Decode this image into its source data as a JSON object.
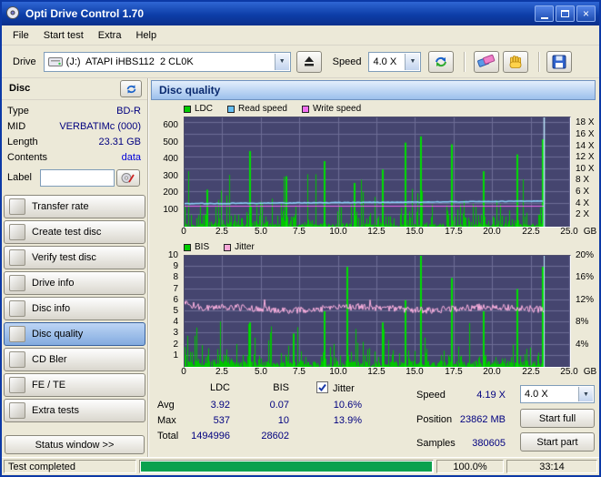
{
  "window": {
    "title": "Opti Drive Control 1.70"
  },
  "menu": {
    "items": [
      "File",
      "Start test",
      "Extra",
      "Help"
    ]
  },
  "toolbar": {
    "drive_label": "Drive",
    "drive_value": "(J:)  ATAPI iHBS112  2 CL0K",
    "speed_label": "Speed",
    "speed_value": "4.0 X"
  },
  "sidebar": {
    "header": "Disc",
    "info": {
      "type_label": "Type",
      "type_value": "BD-R",
      "mid_label": "MID",
      "mid_value": "VERBATIMc (000)",
      "length_label": "Length",
      "length_value": "23.31 GB",
      "contents_label": "Contents",
      "contents_value": "data",
      "label_label": "Label",
      "label_value": ""
    },
    "buttons": [
      "Transfer rate",
      "Create test disc",
      "Verify test disc",
      "Drive info",
      "Disc info",
      "Disc quality",
      "CD Bler",
      "FE / TE",
      "Extra tests"
    ],
    "active_button": "Disc quality",
    "status_window": "Status window >>"
  },
  "main": {
    "header": "Disc quality"
  },
  "results": {
    "col_ldc": "LDC",
    "col_bis": "BIS",
    "col_jitter": "Jitter",
    "jitter_checked": true,
    "rows": [
      {
        "label": "Avg",
        "ldc": "3.92",
        "bis": "0.07",
        "jitter": "10.6%"
      },
      {
        "label": "Max",
        "ldc": "537",
        "bis": "10",
        "jitter": "13.9%"
      },
      {
        "label": "Total",
        "ldc": "1494996",
        "bis": "28602",
        "jitter": ""
      }
    ],
    "speed_label": "Speed",
    "speed_value": "4.19 X",
    "speed_select": "4.0 X",
    "position_label": "Position",
    "position_value": "23862 MB",
    "samples_label": "Samples",
    "samples_value": "380605",
    "start_full": "Start full",
    "start_part": "Start part"
  },
  "statusbar": {
    "status": "Test completed",
    "progress": "100.0%",
    "time": "33:14"
  },
  "colors": {
    "chart_bg": "#45456f",
    "grid": "#6e6e96",
    "accent_green": "#00c400",
    "read_blue": "#8fd4ff",
    "write_magenta": "#f06ef0",
    "jitter_pink": "#ffb2e2",
    "end_marker": "#bfe9ff",
    "value_navy": "#00007f",
    "progress_green": "#0aa14e"
  },
  "chart_data": [
    {
      "type": "area",
      "title": "LDC / read & write speed vs position",
      "legend": [
        {
          "label": "LDC",
          "color": "#00cc00"
        },
        {
          "label": "Read speed",
          "color": "#66bff2"
        },
        {
          "label": "Write speed",
          "color": "#f06ef0"
        }
      ],
      "x_ticks": [
        "0",
        "2.5",
        "5.0",
        "7.5",
        "10.0",
        "12.5",
        "15.0",
        "17.5",
        "20.0",
        "22.5",
        "25.0"
      ],
      "x_unit": "GB",
      "x_max": 25,
      "left_ticks": [
        100,
        200,
        300,
        400,
        500,
        600
      ],
      "left_max": 650,
      "right_ticks": [
        2,
        4,
        6,
        8,
        10,
        12,
        14,
        16,
        18
      ],
      "right_suffix": " X",
      "right_max": 19,
      "end_gb": 23.31,
      "ldc_avg": 3.92,
      "ldc_max": 537,
      "read_start": 4.0,
      "read_end": 4.45,
      "write_speed": 4.0,
      "spikes": [
        [
          0.06,
          220
        ],
        [
          0.18,
          450
        ],
        [
          0.28,
          300
        ],
        [
          0.386,
          390
        ],
        [
          0.47,
          260
        ],
        [
          0.55,
          340
        ],
        [
          0.613,
          500
        ],
        [
          0.656,
          537
        ],
        [
          0.742,
          490
        ],
        [
          0.83,
          330
        ],
        [
          0.922,
          430
        ],
        [
          0.995,
          520
        ]
      ]
    },
    {
      "type": "area",
      "title": "BIS / jitter vs position",
      "legend": [
        {
          "label": "BIS",
          "color": "#00cc00"
        },
        {
          "label": "Jitter",
          "color": "#f8a8d8"
        }
      ],
      "x_ticks": [
        "0",
        "2.5",
        "5.0",
        "7.5",
        "10.0",
        "12.5",
        "15.0",
        "17.5",
        "20.0",
        "22.5",
        "25.0"
      ],
      "x_unit": "GB",
      "x_max": 25,
      "left_ticks": [
        1,
        2,
        3,
        4,
        5,
        6,
        7,
        8,
        9,
        10
      ],
      "left_max": 10,
      "right_ticks": [
        4,
        8,
        12,
        16,
        20
      ],
      "right_suffix": "%",
      "right_max": 20,
      "end_gb": 23.31,
      "bis_avg": 0.07,
      "bis_max": 10,
      "jitter_avg": 10.6,
      "jitter_max": 13.9,
      "spikes": [
        [
          0.18,
          4
        ],
        [
          0.3,
          3
        ],
        [
          0.386,
          5
        ],
        [
          0.45,
          9
        ],
        [
          0.55,
          4
        ],
        [
          0.613,
          6
        ],
        [
          0.656,
          10
        ],
        [
          0.742,
          8
        ],
        [
          0.83,
          5
        ],
        [
          0.922,
          7
        ],
        [
          0.995,
          9
        ]
      ]
    }
  ]
}
